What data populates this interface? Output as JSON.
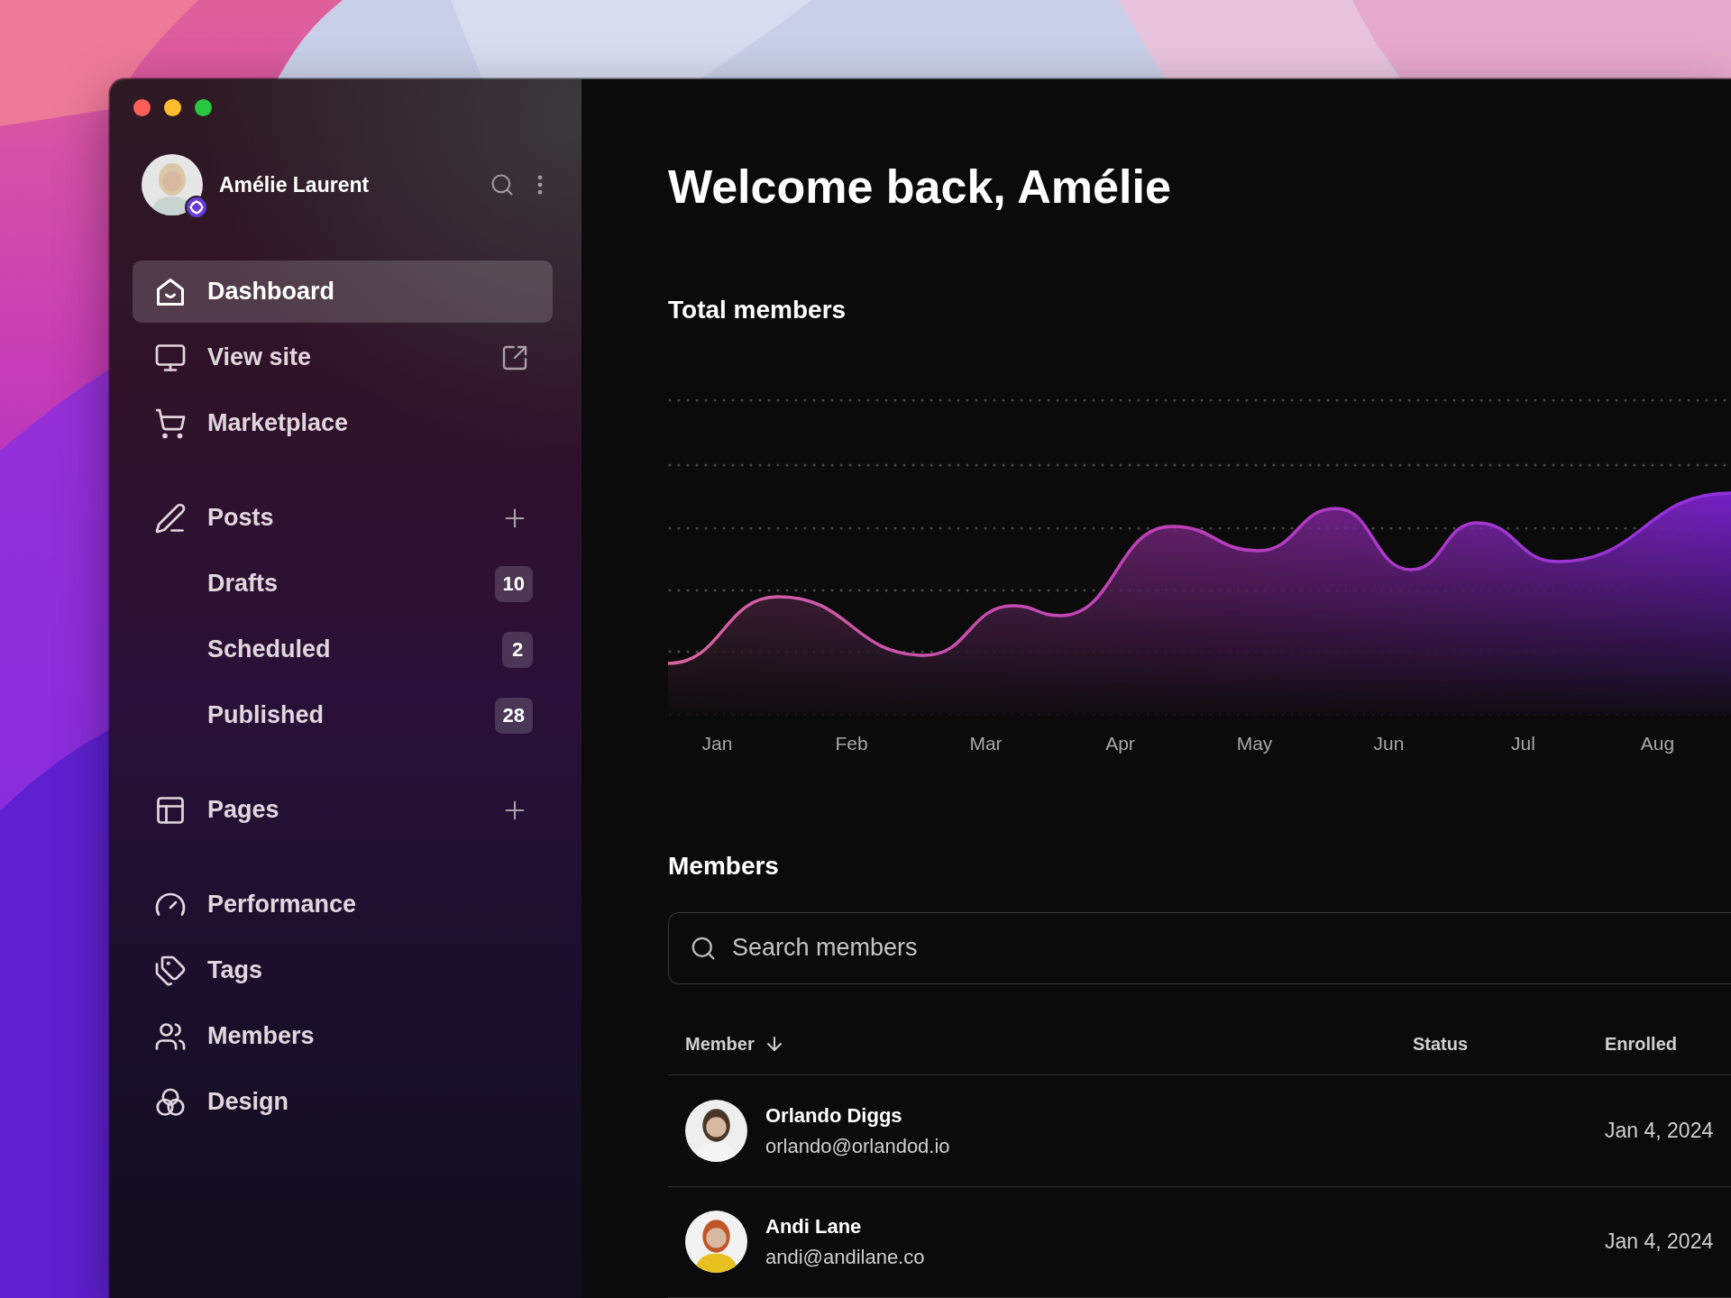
{
  "user": {
    "name": "Amélie Laurent"
  },
  "sidebar": {
    "groups": [
      {
        "items": [
          {
            "label": "Dashboard",
            "selected": true
          },
          {
            "label": "View site",
            "selected": false
          },
          {
            "label": "Marketplace",
            "selected": false
          }
        ]
      },
      {
        "items": [
          {
            "label": "Posts",
            "selected": false,
            "children": [
              {
                "label": "Drafts",
                "count": "10",
                "selected": false
              },
              {
                "label": "Scheduled",
                "count": "2",
                "selected": false
              },
              {
                "label": "Published",
                "count": "28",
                "selected": false
              }
            ]
          }
        ]
      },
      {
        "items": [
          {
            "label": "Pages",
            "selected": false
          }
        ]
      },
      {
        "items": [
          {
            "label": "Performance",
            "selected": false
          },
          {
            "label": "Tags",
            "selected": false
          },
          {
            "label": "Members",
            "selected": false
          },
          {
            "label": "Design",
            "selected": false
          }
        ]
      }
    ]
  },
  "main": {
    "heading": "Welcome back, Amélie",
    "chart": {
      "title": "Total members",
      "months": [
        "Jan",
        "Feb",
        "Mar",
        "Apr",
        "May",
        "Jun",
        "Jul",
        "Aug"
      ]
    },
    "members": {
      "title": "Members",
      "search": {
        "placeholder": "Search members"
      },
      "columns": [
        {
          "label": "Member",
          "sorted": true
        },
        {
          "label": "Status",
          "sorted": false
        },
        {
          "label": "Enrolled",
          "sorted": false
        }
      ],
      "rows": [
        {
          "name": "Orlando Diggs",
          "email": "orlando@orlandod.io",
          "enrolled": "Jan 4, 2024"
        },
        {
          "name": "Andi Lane",
          "email": "andi@andilane.co",
          "enrolled": "Jan 4, 2024"
        }
      ]
    }
  }
}
